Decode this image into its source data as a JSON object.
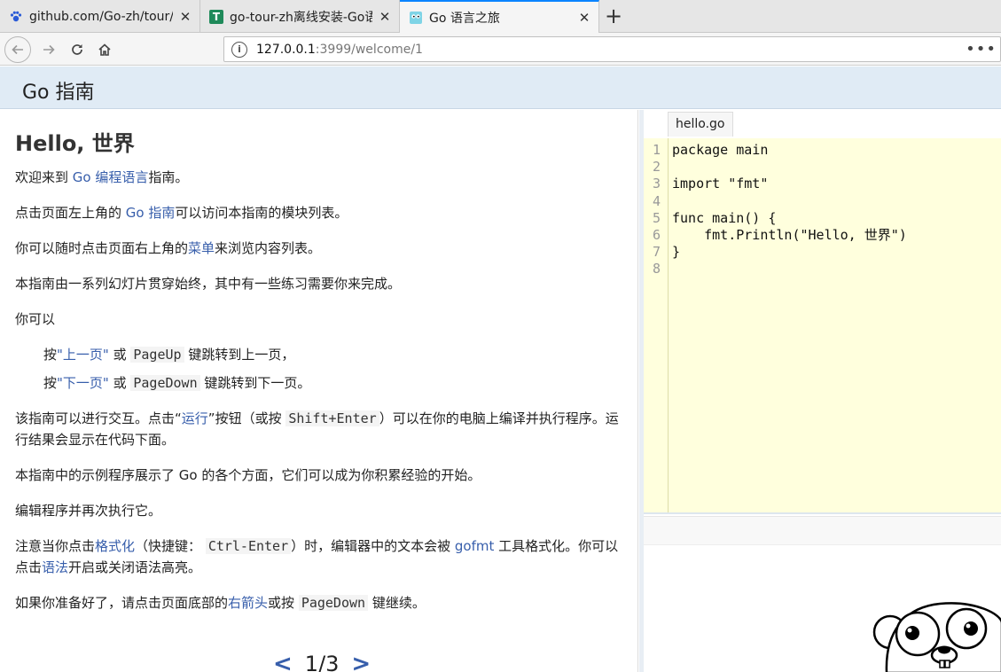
{
  "browser": {
    "tabs": [
      {
        "title": "github.com/Go-zh/tour/go",
        "icon": "paw-icon"
      },
      {
        "title": "go-tour-zh离线安装-Go语",
        "icon": "t-icon"
      },
      {
        "title": "Go 语言之旅",
        "icon": "gopher-icon"
      }
    ],
    "url_host": "127.0.0.1",
    "url_rest": ":3999/welcome/1"
  },
  "header": {
    "brand": "Go 指南"
  },
  "slide": {
    "title": "Hello, 世界",
    "p1_pre": "欢迎来到 ",
    "p1_link": "Go 编程语言",
    "p1_post": "指南。",
    "p2_pre": "点击页面左上角的 ",
    "p2_link": "Go 指南",
    "p2_post": "可以访问本指南的模块列表。",
    "p3_pre": "你可以随时点击页面右上角的",
    "p3_link": "菜单",
    "p3_post": "来浏览内容列表。",
    "p4": "本指南由一系列幻灯片贯穿始终，其中有一些练习需要你来完成。",
    "p5": "你可以",
    "b1_pre": "按",
    "b1_link": "\"上一页\"",
    "b1_mid": " 或 ",
    "b1_key": "PageUp",
    "b1_post": " 键跳转到上一页，",
    "b2_pre": "按",
    "b2_link": "\"下一页\"",
    "b2_mid": " 或 ",
    "b2_key": "PageDown",
    "b2_post": " 键跳转到下一页。",
    "p6_pre": "该指南可以进行交互。点击“",
    "p6_link": "运行",
    "p6_mid": "”按钮（或按 ",
    "p6_key": "Shift+Enter",
    "p6_post": "）可以在你的电脑上编译并执行程序。运行结果会显示在代码下面。",
    "p7": "本指南中的示例程序展示了 Go 的各个方面，它们可以成为你积累经验的开始。",
    "p8": "编辑程序并再次执行它。",
    "p9_pre": "注意当你点击",
    "p9_link1": "格式化",
    "p9_mid1": "（快捷键： ",
    "p9_key": "Ctrl-Enter",
    "p9_mid2": "）时，编辑器中的文本会被 ",
    "p9_link2": "gofmt",
    "p9_mid3": " 工具格式化。你可以点击",
    "p9_link3": "语法",
    "p9_post": "开启或关闭语法高亮。",
    "p10_pre": "如果你准备好了，请点击页面底部的",
    "p10_link": "右箭头",
    "p10_mid": "或按 ",
    "p10_key": "PageDown",
    "p10_post": " 键继续。",
    "pager": {
      "prev": "<",
      "page": "1/3",
      "next": ">"
    }
  },
  "editor": {
    "filename": "hello.go",
    "lines": [
      {
        "n": "1",
        "code": "package main"
      },
      {
        "n": "2",
        "code": ""
      },
      {
        "n": "3",
        "code": "import \"fmt\""
      },
      {
        "n": "4",
        "code": ""
      },
      {
        "n": "5",
        "code": "func main() {"
      },
      {
        "n": "6",
        "code": "    fmt.Println(\"Hello, 世界\")"
      },
      {
        "n": "7",
        "code": "}"
      },
      {
        "n": "8",
        "code": ""
      }
    ]
  },
  "colors": {
    "link": "#375eab",
    "header_bg": "#e0ebf5",
    "editor_bg": "#ffffdd"
  }
}
